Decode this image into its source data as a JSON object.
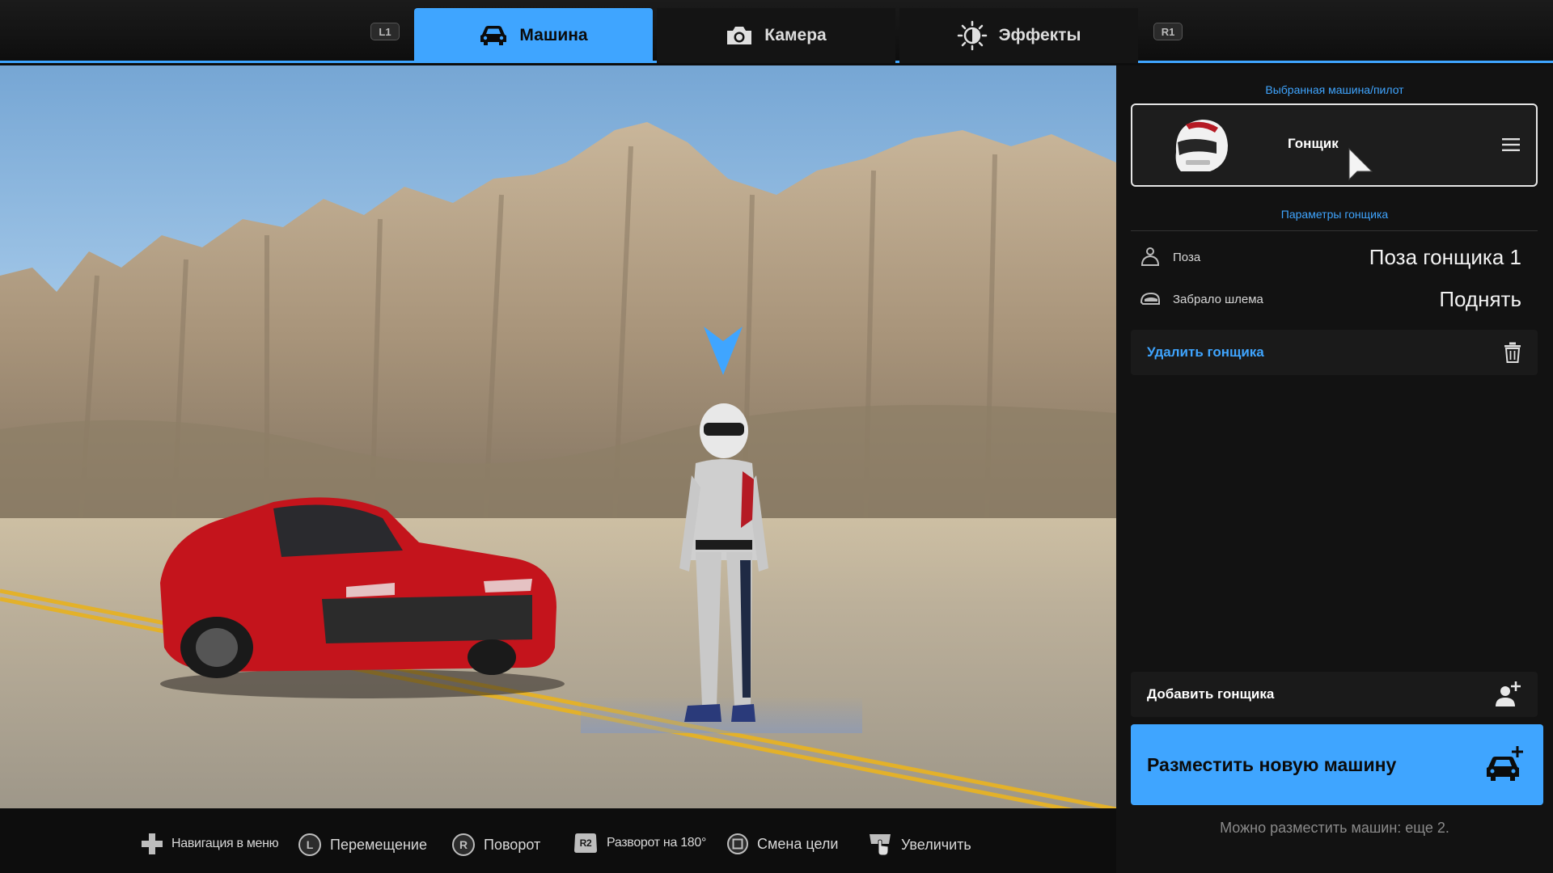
{
  "top_bar": {
    "left_bumper": "L1",
    "right_bumper": "R1",
    "tabs": [
      {
        "label": "Машина",
        "icon": "car-icon",
        "active": true
      },
      {
        "label": "Камера",
        "icon": "camera-icon",
        "active": false
      },
      {
        "label": "Эффекты",
        "icon": "brightness-icon",
        "active": false
      }
    ]
  },
  "panel": {
    "selected_title": "Выбранная машина/пилот",
    "selected_item": {
      "label": "Гонщик",
      "icon": "helmet-icon"
    },
    "params_title": "Параметры гонщика",
    "params": [
      {
        "label": "Поза",
        "value": "Поза гонщика 1",
        "icon": "pose-icon"
      },
      {
        "label": "Забрало шлема",
        "value": "Поднять",
        "icon": "visor-icon"
      }
    ],
    "delete_label": "Удалить гонщика",
    "add_driver_label": "Добавить гонщика",
    "place_car_label": "Разместить новую машину",
    "remaining_note": "Можно разместить машин: еще 2."
  },
  "bottom_hints": [
    {
      "label": "Навигация в меню",
      "icon": "dpad-icon"
    },
    {
      "label": "Перемещение",
      "icon": "left-stick-icon",
      "glyph": "L"
    },
    {
      "label": "Поворот",
      "icon": "right-stick-icon",
      "glyph": "R"
    },
    {
      "label": "Разворот на 180°",
      "icon": "r2-icon",
      "glyph": "R2"
    },
    {
      "label": "Смена цели",
      "icon": "square-button-icon"
    },
    {
      "label": "Увеличить",
      "icon": "touchpad-icon"
    }
  ],
  "colors": {
    "accent": "#3fa5ff",
    "panel_bg": "#121212",
    "car_red": "#c4141c"
  }
}
